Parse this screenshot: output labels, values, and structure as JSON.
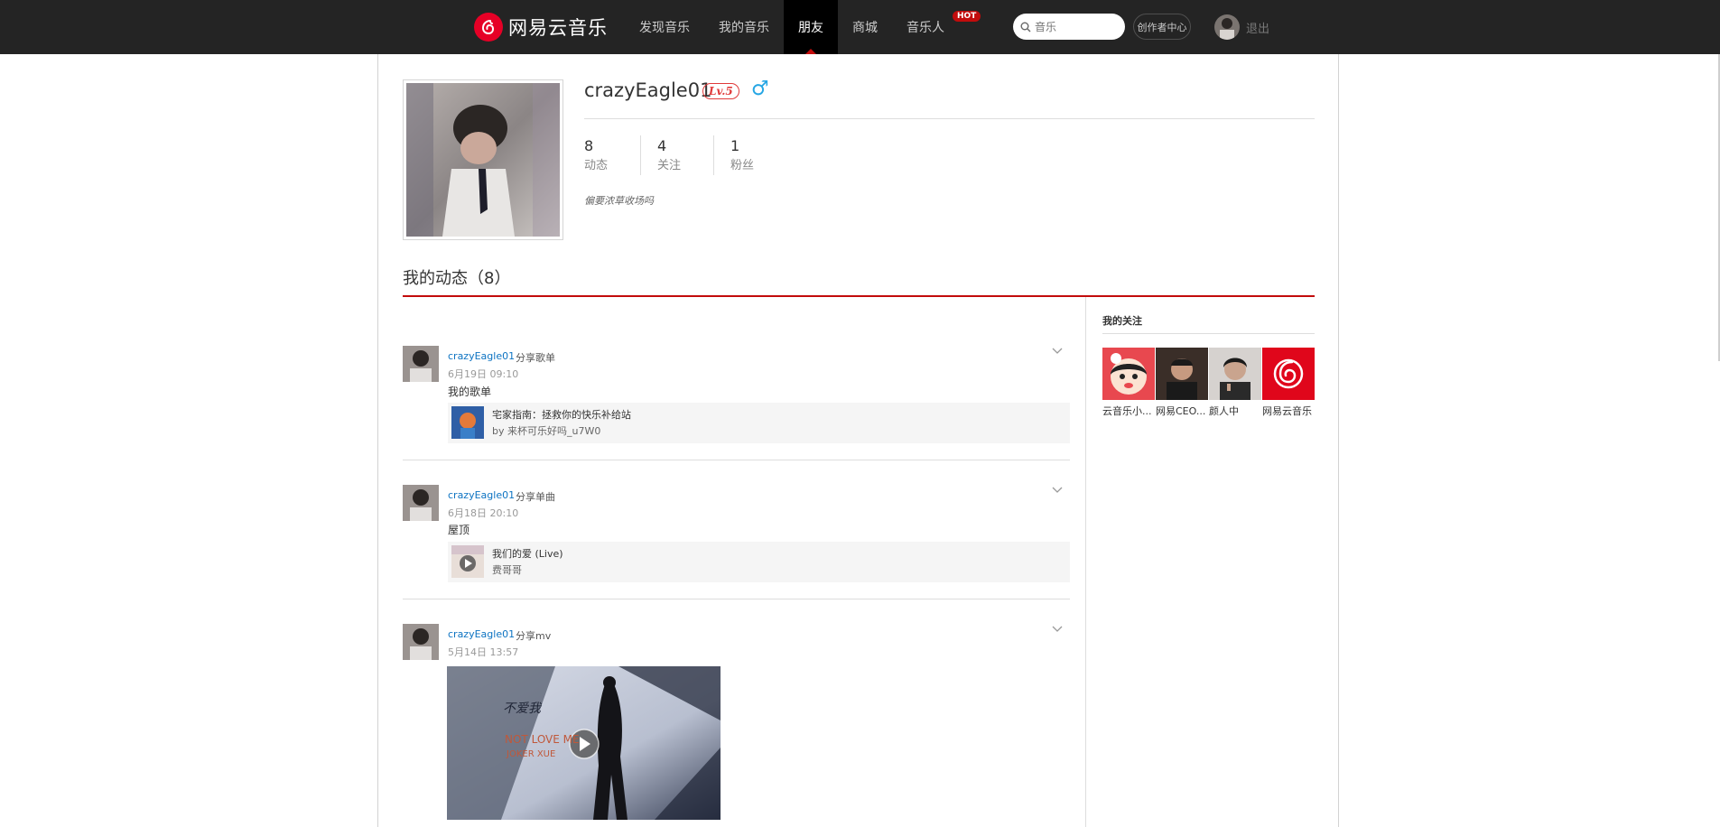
{
  "header": {
    "logo_text": "网易云音乐",
    "nav": [
      {
        "label": "发现音乐"
      },
      {
        "label": "我的音乐"
      },
      {
        "label": "朋友"
      },
      {
        "label": "商城"
      },
      {
        "label": "音乐人"
      }
    ],
    "hot_badge": "HOT",
    "search_placeholder": "音乐",
    "creator_label": "创作者中心",
    "logout_label": "退出",
    "brand_color": "#c20c0c"
  },
  "profile": {
    "username": "crazyEagle01",
    "level": "Lv.5",
    "gender_symbol": "♂",
    "stats": [
      {
        "value": "8",
        "label": "动态"
      },
      {
        "value": "4",
        "label": "关注"
      },
      {
        "value": "1",
        "label": "粉丝"
      }
    ],
    "bio": "偏要浓草收场吗"
  },
  "feed": {
    "title": "我的动态（8）",
    "items": [
      {
        "user": "crazyEagle01",
        "action": "分享歌单",
        "time": "6月19日 09:10",
        "text": "我的歌单",
        "card_title": "宅家指南：拯救你的快乐补给站",
        "card_sub": "by 来杯可乐好吗_u7W0"
      },
      {
        "user": "crazyEagle01",
        "action": "分享单曲",
        "time": "6月18日 20:10",
        "text": "屋顶",
        "card_title": "我们的爱 (Live)",
        "card_sub": "费哥哥"
      },
      {
        "user": "crazyEagle01",
        "action": "分享mv",
        "time": "5月14日 13:57",
        "mv_text": "不爱我",
        "mv_sub": "NOT LOVE ME",
        "mv_artist": "JOKER XUE"
      }
    ]
  },
  "follows": {
    "title": "我的关注",
    "items": [
      {
        "name": "云音乐小..."
      },
      {
        "name": "网易CEO..."
      },
      {
        "name": "颜人中"
      },
      {
        "name": "网易云音乐"
      }
    ]
  }
}
